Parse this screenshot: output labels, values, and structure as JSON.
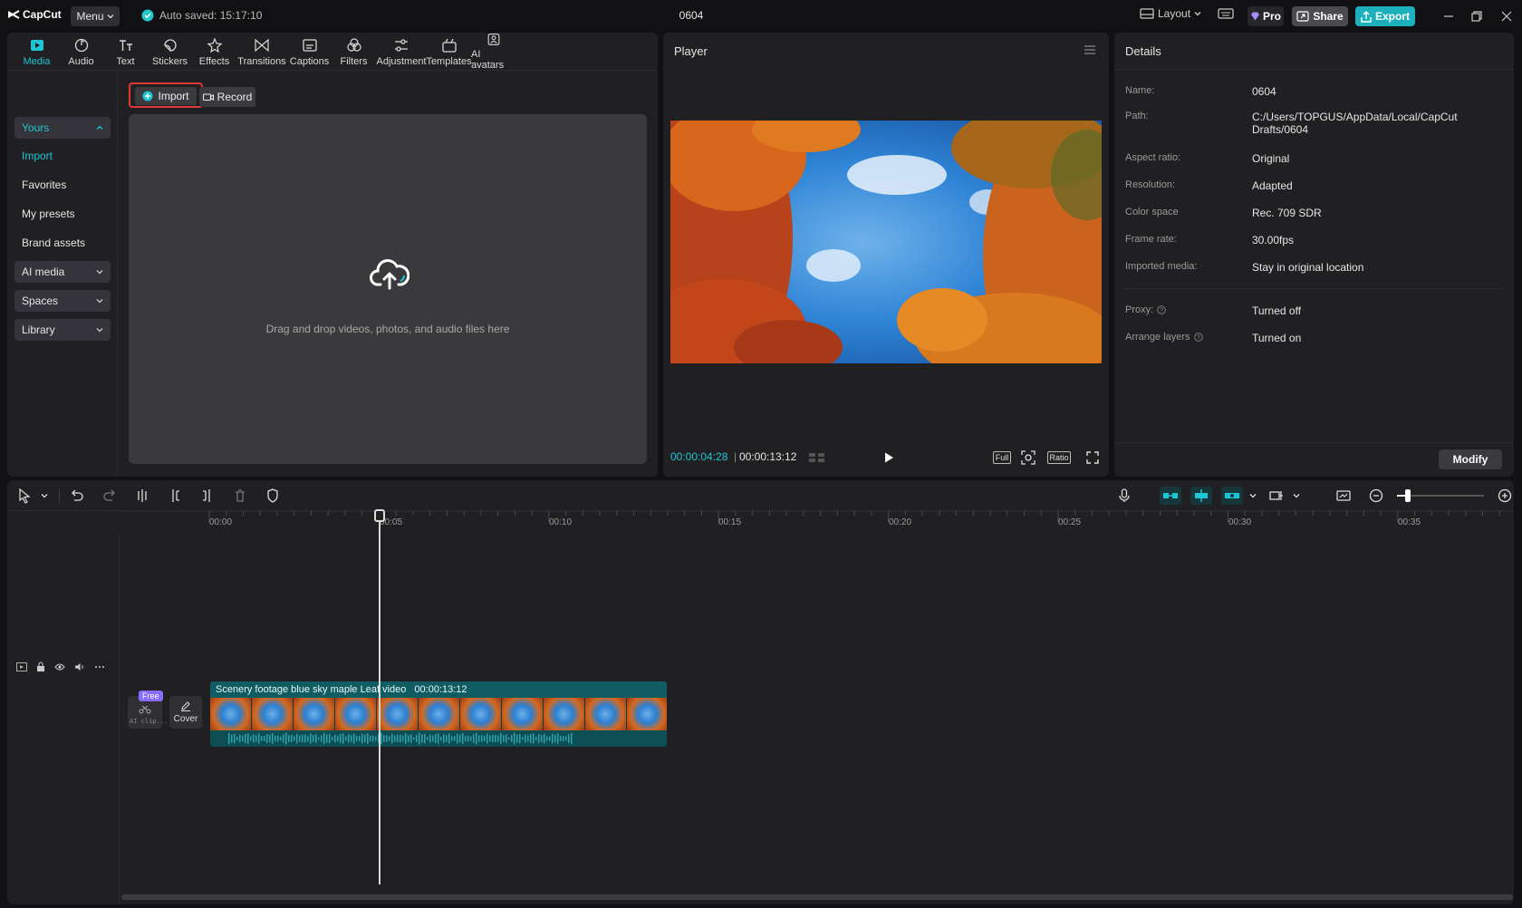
{
  "app": {
    "name": "CapCut",
    "menu_label": "Menu",
    "autosave_text": "Auto saved: 15:17:10",
    "project_title": "0604"
  },
  "titlebar": {
    "layout_label": "Layout",
    "pro_label": "Pro",
    "share_label": "Share",
    "export_label": "Export"
  },
  "tool_tabs": [
    {
      "label": "Media",
      "icon": "media-icon"
    },
    {
      "label": "Audio",
      "icon": "audio-icon"
    },
    {
      "label": "Text",
      "icon": "text-icon"
    },
    {
      "label": "Stickers",
      "icon": "stickers-icon"
    },
    {
      "label": "Effects",
      "icon": "effects-icon"
    },
    {
      "label": "Transitions",
      "icon": "transitions-icon"
    },
    {
      "label": "Captions",
      "icon": "captions-icon"
    },
    {
      "label": "Filters",
      "icon": "filters-icon"
    },
    {
      "label": "Adjustment",
      "icon": "adjustment-icon"
    },
    {
      "label": "Templates",
      "icon": "templates-icon"
    },
    {
      "label": "AI avatars",
      "icon": "ai-avatars-icon"
    }
  ],
  "sidebar": {
    "items": [
      {
        "label": "Yours"
      },
      {
        "label": "Import"
      },
      {
        "label": "Favorites"
      },
      {
        "label": "My presets"
      },
      {
        "label": "Brand assets"
      },
      {
        "label": "AI media"
      },
      {
        "label": "Spaces"
      },
      {
        "label": "Library"
      }
    ]
  },
  "media": {
    "import_label": "Import",
    "record_label": "Record",
    "drop_text": "Drag and drop videos, photos, and audio files here"
  },
  "player": {
    "title": "Player",
    "current_time": "00:00:04:28",
    "total_time": "00:00:13:12",
    "full_label": "Full",
    "ratio_label": "Ratio"
  },
  "details": {
    "title": "Details",
    "rows": [
      {
        "label": "Name:",
        "value": "0604"
      },
      {
        "label": "Path:",
        "value": "C:/Users/TOPGUS/AppData/Local/CapCut Drafts/0604"
      },
      {
        "label": "Aspect ratio:",
        "value": "Original"
      },
      {
        "label": "Resolution:",
        "value": "Adapted"
      },
      {
        "label": "Color space",
        "value": "Rec. 709 SDR"
      },
      {
        "label": "Frame rate:",
        "value": "30.00fps"
      },
      {
        "label": "Imported media:",
        "value": "Stay in original location"
      },
      {
        "label": "Proxy:",
        "value": "Turned off"
      },
      {
        "label": "Arrange layers",
        "value": "Turned on"
      }
    ],
    "modify_label": "Modify"
  },
  "timeline": {
    "ticks": [
      "00:00",
      "00:05",
      "00:10",
      "00:15",
      "00:20",
      "00:25",
      "00:30",
      "00:35"
    ],
    "clip_title": "Scenery footage blue sky maple Leaf video",
    "clip_duration": "00:00:13:12",
    "free_badge": "Free",
    "ai_clip_label": "AI clip...",
    "cover_label": "Cover"
  },
  "colors": {
    "accent": "#1fc5d3",
    "highlight_border": "#e0393a",
    "clip": "#0f5c63"
  }
}
